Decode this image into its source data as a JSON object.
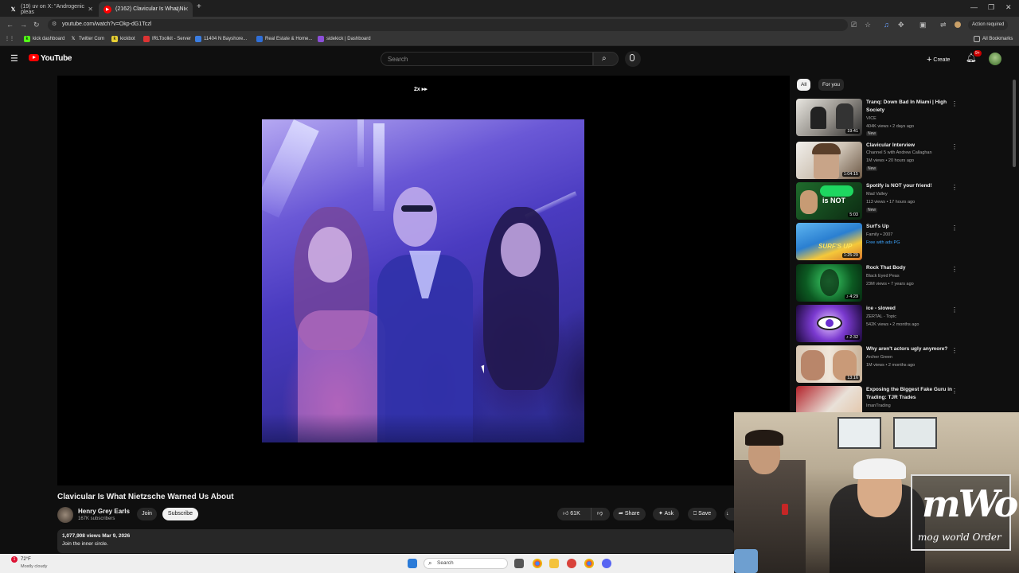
{
  "browser": {
    "tabs": [
      {
        "title": "(19) uv on X: \"Androgenic pleas",
        "icon": "x-logo-icon"
      },
      {
        "title": "(2162) Clavicular Is What Ni",
        "icon": "youtube-icon"
      }
    ],
    "new_tab": "+",
    "url": "youtube.com/watch?v=Okp-dG1Tczl",
    "action_required": "Action required",
    "bookmarks": [
      "kick dashboard",
      "Twitter Com",
      "kickbot",
      "IRLToolkit - Server",
      "11404 N Bayshore...",
      "Real Estate & Home...",
      "sidekick | Dashboard"
    ],
    "all_bookmarks": "All Bookmarks"
  },
  "youtube": {
    "logo": "YouTube",
    "search_placeholder": "Search",
    "create": "Create",
    "notif_count": "9+"
  },
  "player": {
    "speed": "2x ▸▸"
  },
  "video": {
    "title": "Clavicular Is What Nietzsche Warned Us About",
    "channel": "Henry Grey Earls",
    "subscribers": "167K subscribers",
    "join": "Join",
    "subscribe": "Subscribe",
    "likes": "61K",
    "share": "Share",
    "ask": "Ask",
    "save": "Save",
    "views_date": "1,077,908 views  Mar 9, 2026",
    "description": "Join the inner circle."
  },
  "sidebar": {
    "chips": [
      "All",
      "For you"
    ],
    "recommendations": [
      {
        "title": "Tranq: Down Bad In Miami | High Society",
        "channel": "VICE",
        "meta": "404K views • 2 days ago",
        "badge": "New",
        "duration": "19:41"
      },
      {
        "title": "Clavicular Interview",
        "channel": "Channel 5 with Andrew Callaghan",
        "meta": "1M views • 20 hours ago",
        "badge": "New",
        "duration": "1:04:15"
      },
      {
        "title": "Spotify is NOT your friend!",
        "channel": "Mad Valley",
        "meta": "113 views • 17 hours ago",
        "badge": "New",
        "duration": "5:03"
      },
      {
        "title": "Surf's Up",
        "channel": "Family • 2007",
        "meta": "Free with ads  PG",
        "badge": "",
        "duration": "1:25:29"
      },
      {
        "title": "Rock That Body",
        "channel": "Black Eyed Peas",
        "meta": "23M views • 7 years ago",
        "badge": "",
        "duration": "♪ 4:29"
      },
      {
        "title": "ice - slowed",
        "channel": "ZERTAL - Topic",
        "meta": "542K views • 2 months ago",
        "badge": "",
        "duration": "♪ 2:32"
      },
      {
        "title": "Why aren't actors ugly anymore?",
        "channel": "Archer Green",
        "meta": "1M views • 2 months ago",
        "badge": "",
        "duration": "13:16"
      },
      {
        "title": "Exposing the Biggest Fake Guru in Trading: TJR Trades",
        "channel": "ImanTrading",
        "meta": "",
        "badge": "",
        "duration": ""
      }
    ]
  },
  "overlay": {
    "logo_big": "mWo",
    "logo_small": "mog world Order"
  },
  "taskbar": {
    "temp": "72°F",
    "weather": "Mostly cloudy",
    "weather_badge": "1",
    "search": "Search"
  },
  "colors": {
    "yt_red": "#ff0000",
    "background": "#0f0f0f",
    "video_purple": "#4a3bc0"
  }
}
